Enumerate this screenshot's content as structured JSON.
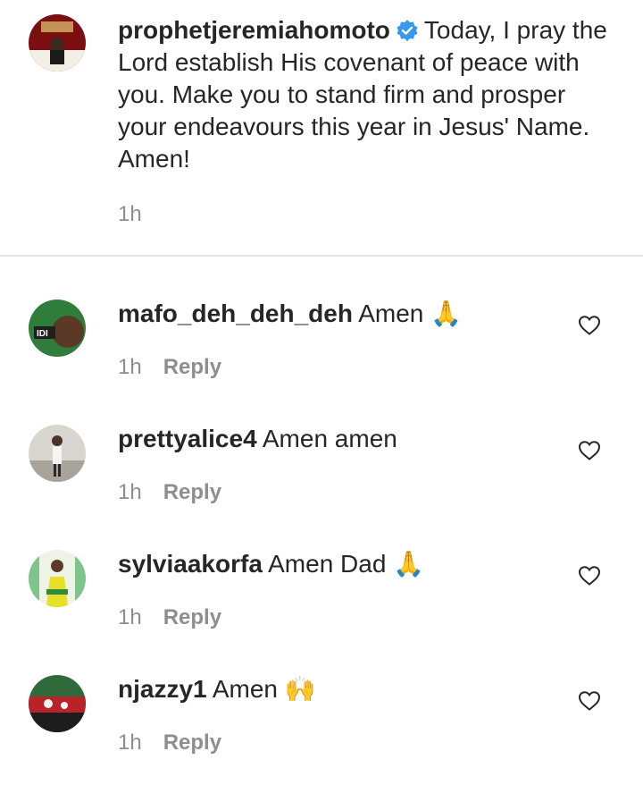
{
  "caption": {
    "username": "prophetjeremiahomoto",
    "verified_icon": "verified-badge-icon",
    "text": "Today, I pray the Lord establish His covenant of peace with you. Make you to stand firm and prosper your endeavours this year in Jesus' Name. Amen!",
    "time": "1h"
  },
  "comments": [
    {
      "username": "mafo_deh_deh_deh",
      "text": "Amen",
      "emoji": "🙏",
      "time": "1h",
      "reply_label": "Reply",
      "like_icon": "heart-outline-icon"
    },
    {
      "username": "prettyalice4",
      "text": "Amen amen",
      "emoji": "",
      "time": "1h",
      "reply_label": "Reply",
      "like_icon": "heart-outline-icon"
    },
    {
      "username": "sylviaakorfa",
      "text": "Amen Dad",
      "emoji": "🙏",
      "time": "1h",
      "reply_label": "Reply",
      "like_icon": "heart-outline-icon"
    },
    {
      "username": "njazzy1",
      "text": "Amen",
      "emoji": "🙌",
      "time": "1h",
      "reply_label": "Reply",
      "like_icon": "heart-outline-icon"
    }
  ],
  "colors": {
    "text": "#262626",
    "secondary": "#8e8e8e",
    "verified": "#3897f0",
    "divider": "#e5e5e5"
  }
}
